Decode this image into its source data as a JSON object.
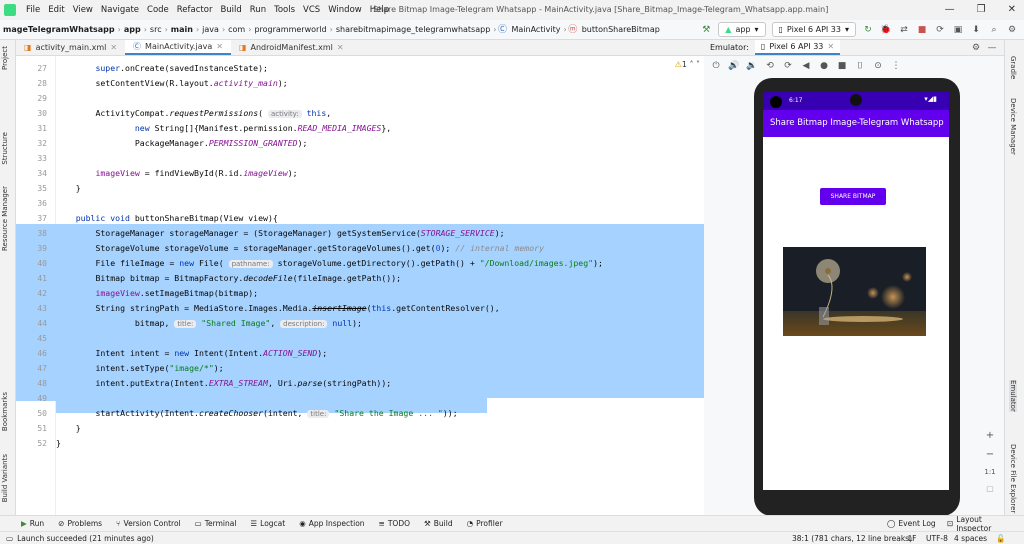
{
  "menu": {
    "items": [
      "File",
      "Edit",
      "View",
      "Navigate",
      "Code",
      "Refactor",
      "Build",
      "Run",
      "Tools",
      "VCS",
      "Window",
      "Help"
    ],
    "window_title": "Share Bitmap Image-Telegram Whatsapp - MainActivity.java [Share_Bitmap_Image-Telegram_Whatsapp.app.main]"
  },
  "nav": {
    "crumbs": [
      "mageTelegramWhatsapp",
      "app",
      "src",
      "main",
      "java",
      "com",
      "programmerworld",
      "sharebitmapimage_telegramwhatsapp",
      "MainActivity",
      "buttonShareBitmap"
    ],
    "run_config": "app",
    "device": "Pixel 6 API 33"
  },
  "tabs": [
    {
      "label": "activity_main.xml",
      "active": false
    },
    {
      "label": "MainActivity.java",
      "active": true
    },
    {
      "label": "AndroidManifest.xml",
      "active": false
    }
  ],
  "left_tools": [
    "Project",
    "Structure",
    "Resource Manager",
    "Bookmarks",
    "Build Variants"
  ],
  "right_tools": [
    "Gradle",
    "Device Manager",
    "Emulator",
    "Device File Explorer"
  ],
  "editor": {
    "warning_count": "1",
    "line_numbers": [
      "27",
      "28",
      "29",
      "30",
      "31",
      "32",
      "33",
      "34",
      "35",
      "36",
      "37",
      "38",
      "39",
      "40",
      "41",
      "42",
      "43",
      "44",
      "45",
      "46",
      "47",
      "48",
      "49",
      "50",
      "51",
      "52"
    ]
  },
  "emulator": {
    "label": "Emulator:",
    "device_tab": "Pixel 6 API 33",
    "time": "6:17",
    "app_title": "Share Bitmap Image-Telegram Whatsapp",
    "share_button": "SHARE BITMAP"
  },
  "zoom": {
    "plus": "+",
    "minus": "−",
    "ratio": "1:1"
  },
  "bottom_tools": [
    {
      "label": "Run",
      "icon": "run-icon"
    },
    {
      "label": "Problems",
      "icon": "problems-icon"
    },
    {
      "label": "Version Control",
      "icon": "vcs-icon"
    },
    {
      "label": "Terminal",
      "icon": "terminal-icon"
    },
    {
      "label": "Logcat",
      "icon": "logcat-icon"
    },
    {
      "label": "App Inspection",
      "icon": "inspection-icon"
    },
    {
      "label": "TODO",
      "icon": "todo-icon"
    },
    {
      "label": "Build",
      "icon": "build-icon"
    },
    {
      "label": "Profiler",
      "icon": "profiler-icon"
    }
  ],
  "bottom_right_tools": [
    "Event Log",
    "Layout Inspector"
  ],
  "status": {
    "message": "Launch succeeded (21 minutes ago)",
    "position": "38:1 (781 chars, 12 line breaks)",
    "line_sep": "LF",
    "encoding": "UTF-8",
    "indent": "4 spaces"
  },
  "colors": {
    "accent": "#6200ee",
    "status_bar": "#3700b3",
    "selection": "#a6d2ff"
  }
}
